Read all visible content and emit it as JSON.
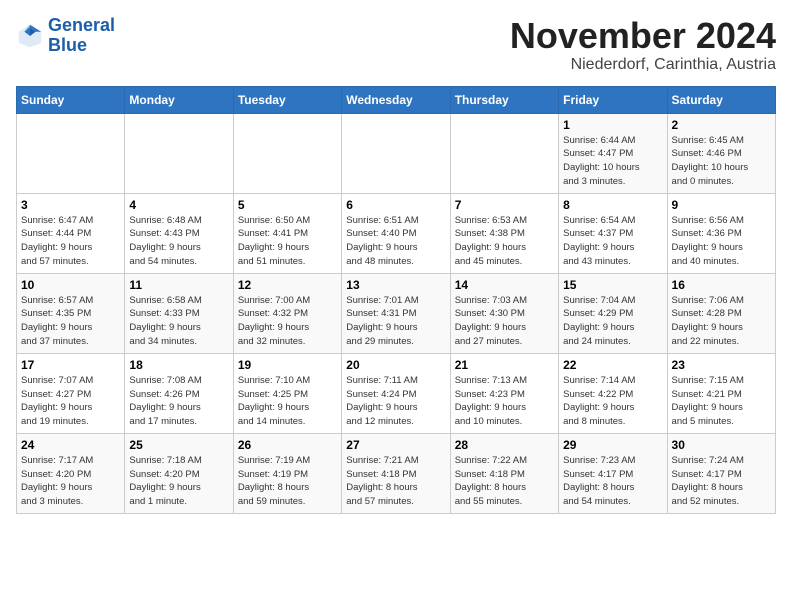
{
  "logo": {
    "line1": "General",
    "line2": "Blue"
  },
  "title": "November 2024",
  "subtitle": "Niederdorf, Carinthia, Austria",
  "days_of_week": [
    "Sunday",
    "Monday",
    "Tuesday",
    "Wednesday",
    "Thursday",
    "Friday",
    "Saturday"
  ],
  "weeks": [
    [
      {
        "day": "",
        "info": ""
      },
      {
        "day": "",
        "info": ""
      },
      {
        "day": "",
        "info": ""
      },
      {
        "day": "",
        "info": ""
      },
      {
        "day": "",
        "info": ""
      },
      {
        "day": "1",
        "info": "Sunrise: 6:44 AM\nSunset: 4:47 PM\nDaylight: 10 hours\nand 3 minutes."
      },
      {
        "day": "2",
        "info": "Sunrise: 6:45 AM\nSunset: 4:46 PM\nDaylight: 10 hours\nand 0 minutes."
      }
    ],
    [
      {
        "day": "3",
        "info": "Sunrise: 6:47 AM\nSunset: 4:44 PM\nDaylight: 9 hours\nand 57 minutes."
      },
      {
        "day": "4",
        "info": "Sunrise: 6:48 AM\nSunset: 4:43 PM\nDaylight: 9 hours\nand 54 minutes."
      },
      {
        "day": "5",
        "info": "Sunrise: 6:50 AM\nSunset: 4:41 PM\nDaylight: 9 hours\nand 51 minutes."
      },
      {
        "day": "6",
        "info": "Sunrise: 6:51 AM\nSunset: 4:40 PM\nDaylight: 9 hours\nand 48 minutes."
      },
      {
        "day": "7",
        "info": "Sunrise: 6:53 AM\nSunset: 4:38 PM\nDaylight: 9 hours\nand 45 minutes."
      },
      {
        "day": "8",
        "info": "Sunrise: 6:54 AM\nSunset: 4:37 PM\nDaylight: 9 hours\nand 43 minutes."
      },
      {
        "day": "9",
        "info": "Sunrise: 6:56 AM\nSunset: 4:36 PM\nDaylight: 9 hours\nand 40 minutes."
      }
    ],
    [
      {
        "day": "10",
        "info": "Sunrise: 6:57 AM\nSunset: 4:35 PM\nDaylight: 9 hours\nand 37 minutes."
      },
      {
        "day": "11",
        "info": "Sunrise: 6:58 AM\nSunset: 4:33 PM\nDaylight: 9 hours\nand 34 minutes."
      },
      {
        "day": "12",
        "info": "Sunrise: 7:00 AM\nSunset: 4:32 PM\nDaylight: 9 hours\nand 32 minutes."
      },
      {
        "day": "13",
        "info": "Sunrise: 7:01 AM\nSunset: 4:31 PM\nDaylight: 9 hours\nand 29 minutes."
      },
      {
        "day": "14",
        "info": "Sunrise: 7:03 AM\nSunset: 4:30 PM\nDaylight: 9 hours\nand 27 minutes."
      },
      {
        "day": "15",
        "info": "Sunrise: 7:04 AM\nSunset: 4:29 PM\nDaylight: 9 hours\nand 24 minutes."
      },
      {
        "day": "16",
        "info": "Sunrise: 7:06 AM\nSunset: 4:28 PM\nDaylight: 9 hours\nand 22 minutes."
      }
    ],
    [
      {
        "day": "17",
        "info": "Sunrise: 7:07 AM\nSunset: 4:27 PM\nDaylight: 9 hours\nand 19 minutes."
      },
      {
        "day": "18",
        "info": "Sunrise: 7:08 AM\nSunset: 4:26 PM\nDaylight: 9 hours\nand 17 minutes."
      },
      {
        "day": "19",
        "info": "Sunrise: 7:10 AM\nSunset: 4:25 PM\nDaylight: 9 hours\nand 14 minutes."
      },
      {
        "day": "20",
        "info": "Sunrise: 7:11 AM\nSunset: 4:24 PM\nDaylight: 9 hours\nand 12 minutes."
      },
      {
        "day": "21",
        "info": "Sunrise: 7:13 AM\nSunset: 4:23 PM\nDaylight: 9 hours\nand 10 minutes."
      },
      {
        "day": "22",
        "info": "Sunrise: 7:14 AM\nSunset: 4:22 PM\nDaylight: 9 hours\nand 8 minutes."
      },
      {
        "day": "23",
        "info": "Sunrise: 7:15 AM\nSunset: 4:21 PM\nDaylight: 9 hours\nand 5 minutes."
      }
    ],
    [
      {
        "day": "24",
        "info": "Sunrise: 7:17 AM\nSunset: 4:20 PM\nDaylight: 9 hours\nand 3 minutes."
      },
      {
        "day": "25",
        "info": "Sunrise: 7:18 AM\nSunset: 4:20 PM\nDaylight: 9 hours\nand 1 minute."
      },
      {
        "day": "26",
        "info": "Sunrise: 7:19 AM\nSunset: 4:19 PM\nDaylight: 8 hours\nand 59 minutes."
      },
      {
        "day": "27",
        "info": "Sunrise: 7:21 AM\nSunset: 4:18 PM\nDaylight: 8 hours\nand 57 minutes."
      },
      {
        "day": "28",
        "info": "Sunrise: 7:22 AM\nSunset: 4:18 PM\nDaylight: 8 hours\nand 55 minutes."
      },
      {
        "day": "29",
        "info": "Sunrise: 7:23 AM\nSunset: 4:17 PM\nDaylight: 8 hours\nand 54 minutes."
      },
      {
        "day": "30",
        "info": "Sunrise: 7:24 AM\nSunset: 4:17 PM\nDaylight: 8 hours\nand 52 minutes."
      }
    ]
  ]
}
